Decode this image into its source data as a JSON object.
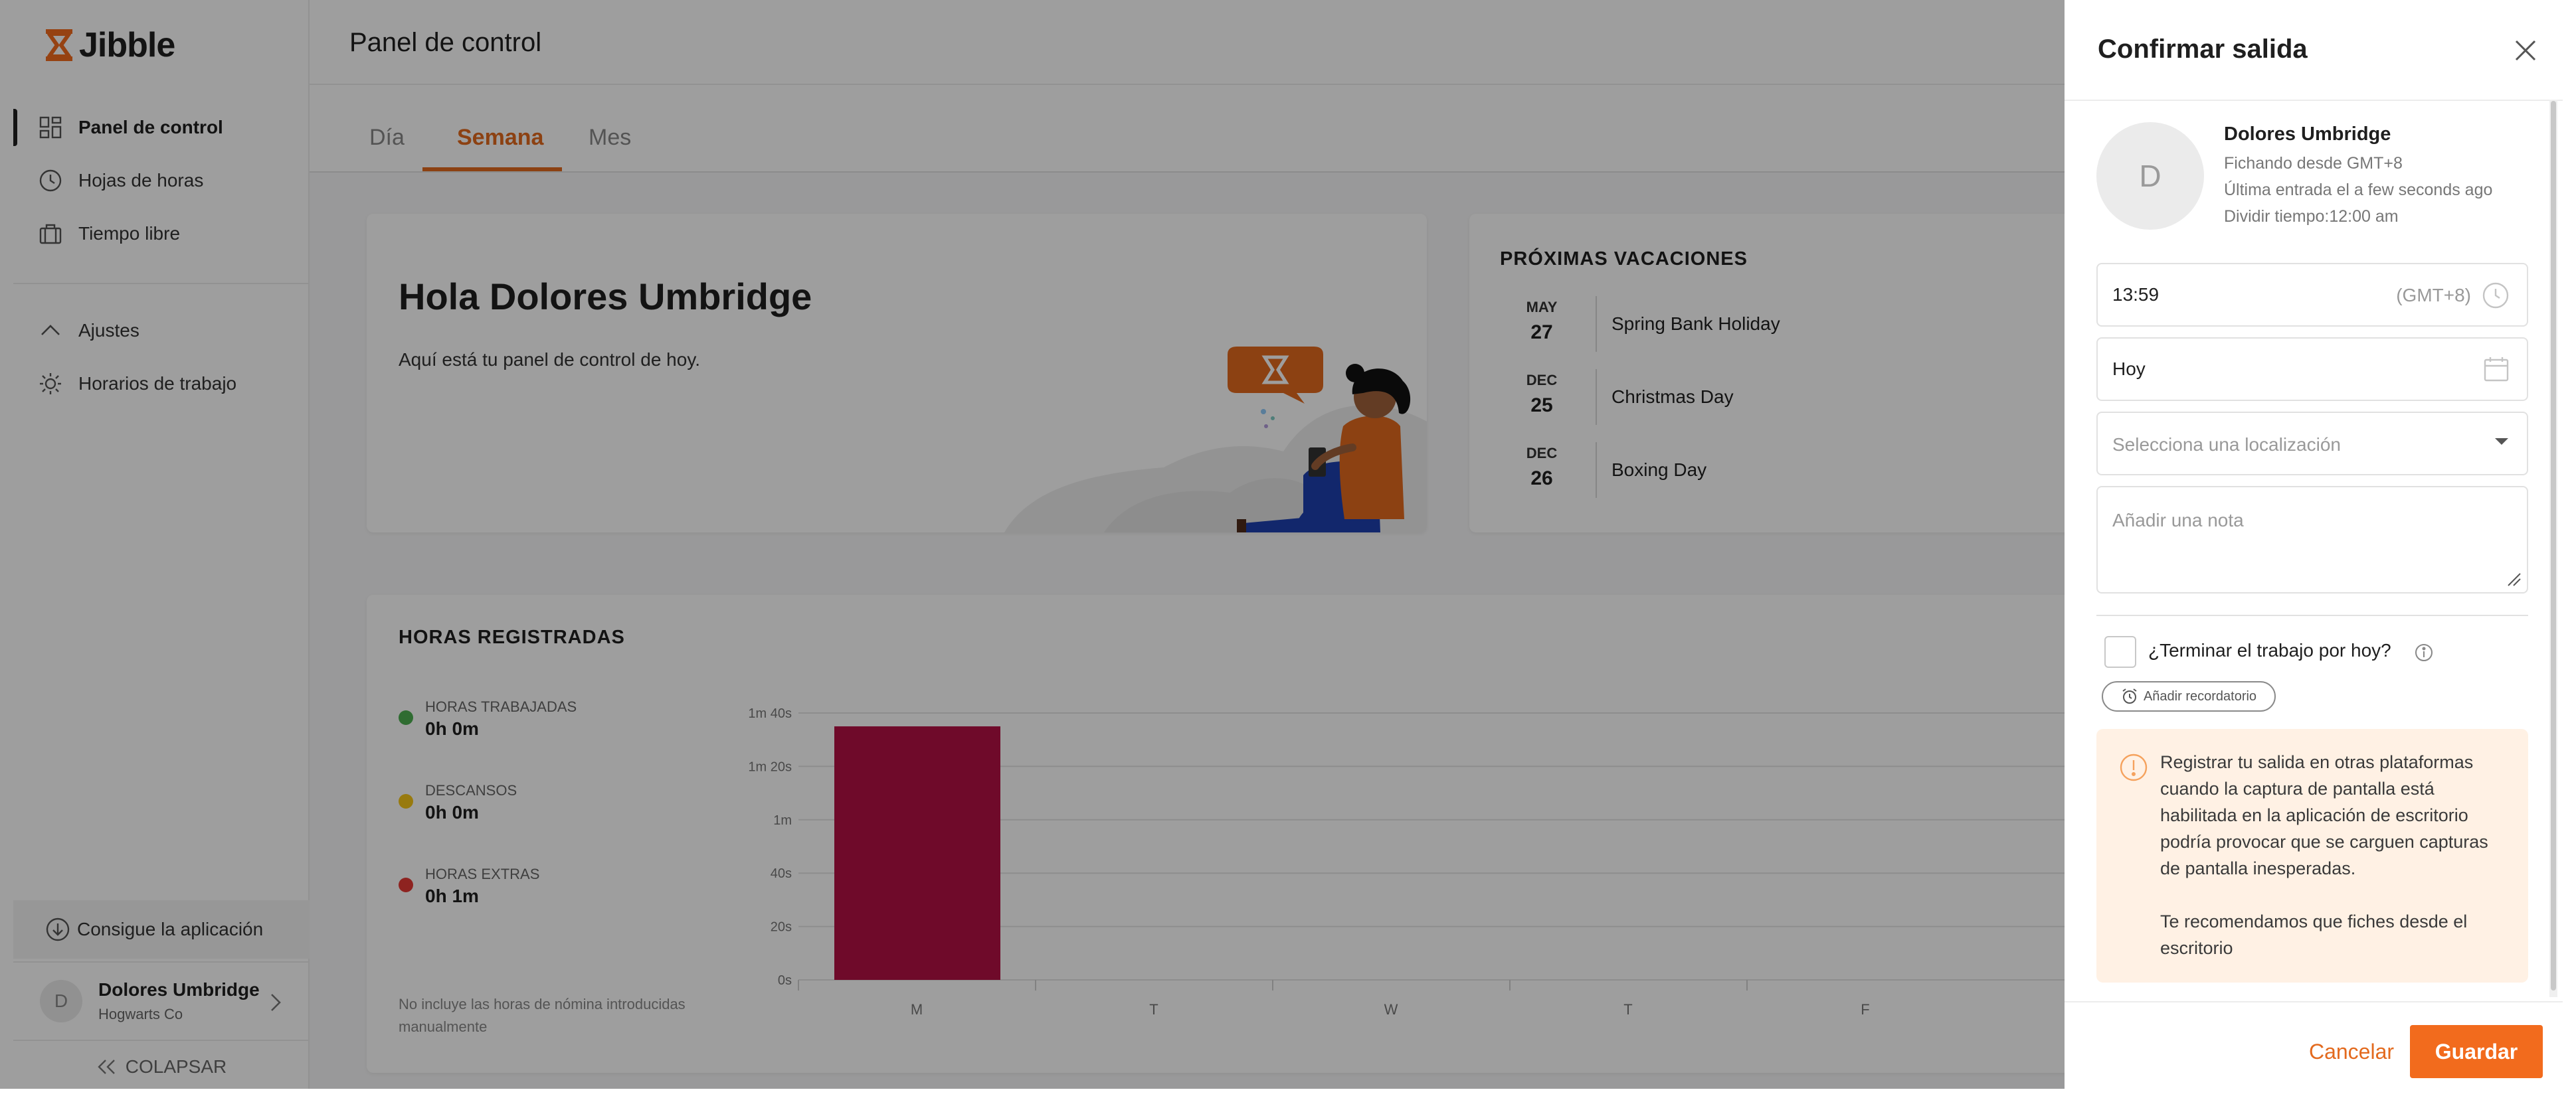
{
  "app": {
    "brand": "Jibble"
  },
  "sidebar": {
    "items": [
      {
        "label": "Panel de control",
        "icon": "dashboard-icon",
        "active": true
      },
      {
        "label": "Hojas de horas",
        "icon": "clock-icon"
      },
      {
        "label": "Tiempo libre",
        "icon": "briefcase-icon"
      }
    ],
    "settings": [
      {
        "label": "Ajustes",
        "icon": "chevron-up-icon"
      },
      {
        "label": "Horarios de trabajo",
        "icon": "sun-gear-icon"
      }
    ],
    "get_app": "Consigue la aplicación",
    "user": {
      "initial": "D",
      "name": "Dolores Umbridge",
      "company": "Hogwarts Co"
    },
    "collapse": "COLAPSAR"
  },
  "header": {
    "title": "Panel de control"
  },
  "tabs": [
    "Día",
    "Semana",
    "Mes"
  ],
  "active_tab": "Semana",
  "hero": {
    "title": "Hola Dolores Umbridge",
    "subtitle": "Aquí está tu panel de control de hoy."
  },
  "vacations": {
    "title": "PRÓXIMAS VACACIONES",
    "items": [
      {
        "month": "MAY",
        "day": "27",
        "name": "Spring Bank Holiday"
      },
      {
        "month": "DEC",
        "day": "25",
        "name": "Christmas Day"
      },
      {
        "month": "DEC",
        "day": "26",
        "name": "Boxing Day"
      }
    ]
  },
  "hours": {
    "title": "HORAS REGISTRADAS",
    "legend": [
      {
        "label": "HORAS TRABAJADAS",
        "value": "0h 0m",
        "color": "#4caf50"
      },
      {
        "label": "DESCANSOS",
        "value": "0h 0m",
        "color": "#f5c518"
      },
      {
        "label": "HORAS EXTRAS",
        "value": "0h 1m",
        "color": "#e53935"
      }
    ],
    "note": "No incluye las horas de nómina introducidas manualmente"
  },
  "chart_data": {
    "type": "bar",
    "categories": [
      "M",
      "T",
      "W",
      "T",
      "F"
    ],
    "y_ticks": [
      "0s",
      "20s",
      "40s",
      "1m",
      "1m 20s",
      "1m 40s"
    ],
    "ylim": [
      0,
      100
    ],
    "series": [
      {
        "values": [
          95,
          0,
          0,
          0,
          0
        ],
        "color": "#b31145"
      }
    ],
    "grid": true
  },
  "drawer": {
    "title": "Confirmar salida",
    "avatar_initial": "D",
    "name": "Dolores Umbridge",
    "line1": "Fichando desde GMT+8",
    "line2": "Última entrada el a few seconds ago",
    "line3": "Dividir tiempo:12:00 am",
    "time_value": "13:59",
    "timezone": "(GMT+8)",
    "date_value": "Hoy",
    "location_placeholder": "Selecciona una localización",
    "note_placeholder": "Añadir una nota",
    "end_work_label": "¿Terminar el trabajo por hoy?",
    "reminder_label": "Añadir recordatorio",
    "alert_p1": "Registrar tu salida en otras plataformas cuando la captura de pantalla está habilitada en la aplicación de escritorio podría provocar que se carguen capturas de pantalla inesperadas.",
    "alert_p2": "Te recomendamos que fiches desde el escritorio",
    "cancel": "Cancelar",
    "save": "Guardar"
  },
  "colors": {
    "accent": "#f26b1d",
    "bar": "#b31145",
    "overlay": "rgba(0,0,0,0.38)",
    "alert_bg": "#fff1e4"
  }
}
